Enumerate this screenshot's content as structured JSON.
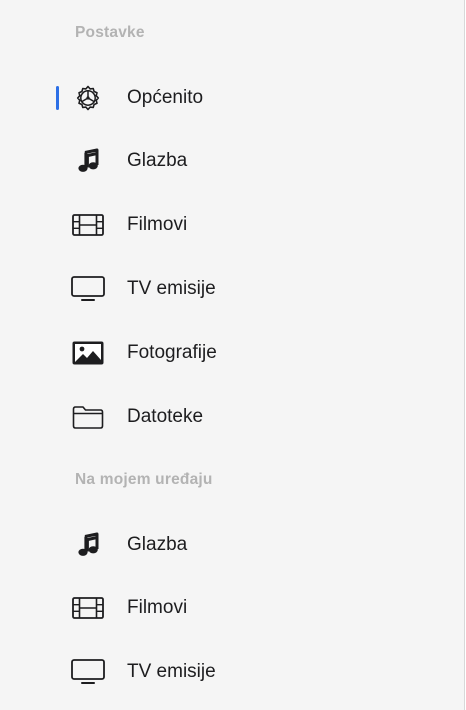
{
  "sections": [
    {
      "header": "Postavke",
      "items": [
        {
          "label": "Općenito",
          "icon": "gear-icon",
          "selected": true
        },
        {
          "label": "Glazba",
          "icon": "music-note-icon",
          "selected": false
        },
        {
          "label": "Filmovi",
          "icon": "film-icon",
          "selected": false
        },
        {
          "label": "TV emisije",
          "icon": "tv-icon",
          "selected": false
        },
        {
          "label": "Fotografije",
          "icon": "photo-icon",
          "selected": false
        },
        {
          "label": "Datoteke",
          "icon": "folder-icon",
          "selected": false
        }
      ]
    },
    {
      "header": "Na mojem uređaju",
      "items": [
        {
          "label": "Glazba",
          "icon": "music-note-icon",
          "selected": false
        },
        {
          "label": "Filmovi",
          "icon": "film-icon",
          "selected": false
        },
        {
          "label": "TV emisije",
          "icon": "tv-icon",
          "selected": false
        }
      ]
    }
  ],
  "colors": {
    "selection_indicator": "#2c6fe6",
    "section_header": "#b3b3b3",
    "label": "#1d1d1f",
    "background": "#f5f5f5"
  }
}
